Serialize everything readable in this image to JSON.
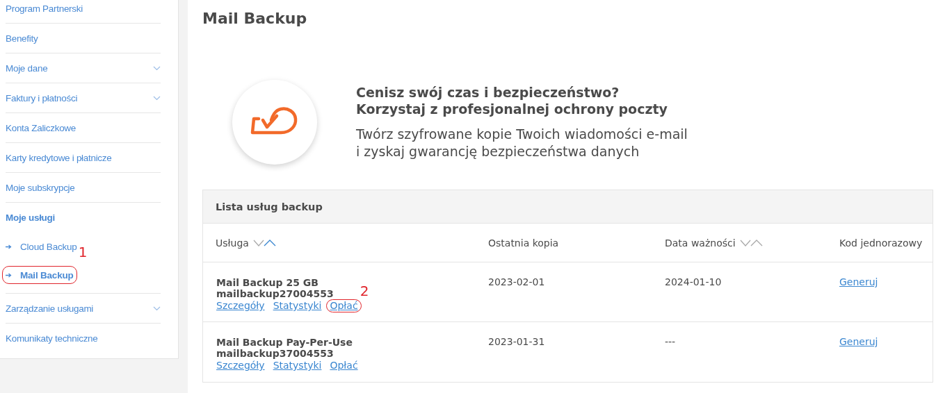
{
  "sidebar": {
    "items": [
      {
        "label": "Program Partnerski",
        "kind": "link"
      },
      {
        "label": "Benefity",
        "kind": "link"
      },
      {
        "label": "Moje dane",
        "kind": "group"
      },
      {
        "label": "Faktury i płatności",
        "kind": "group"
      },
      {
        "label": "Konta Zaliczkowe",
        "kind": "link"
      },
      {
        "label": "Karty kredytowe i płatnicze",
        "kind": "link"
      },
      {
        "label": "Moje subskrypcje",
        "kind": "link"
      },
      {
        "label": "Moje usługi",
        "kind": "section",
        "children": [
          {
            "label": "Cloud Backup",
            "selected": false
          },
          {
            "label": "Mail Backup",
            "selected": true,
            "annotation": "1"
          }
        ]
      },
      {
        "label": "Zarządzanie usługami",
        "kind": "group"
      },
      {
        "label": "Komunikaty techniczne",
        "kind": "link"
      }
    ]
  },
  "page_title": "Mail Backup",
  "banner": {
    "heading": [
      "Cenisz swój czas i bezpieczeństwo?",
      "Korzystaj z profesjonalnej ochrony poczty"
    ],
    "text": [
      "Twórz szyfrowane kopie Twoich wiadomości e-mail",
      "i zyskaj gwarancję bezpieczeństwa danych"
    ]
  },
  "table": {
    "title": "Lista usług backup",
    "columns": [
      {
        "label": "Usługa",
        "sorted": true
      },
      {
        "label": "Ostatnia kopia"
      },
      {
        "label": "Data ważności",
        "sorted": false
      },
      {
        "label": "Kod jednorazowy"
      }
    ],
    "rows": [
      {
        "service": "Mail Backup 25 GB",
        "account": "mailbackup27004553",
        "actions": [
          {
            "label": "Szczegóły"
          },
          {
            "label": "Statystyki"
          },
          {
            "label": "Opłać",
            "annotation": "2"
          }
        ],
        "last_backup": "2023-02-01",
        "expiry": "2024-01-10",
        "code": "Generuj"
      },
      {
        "service": "Mail Backup Pay-Per-Use",
        "account": "mailbackup37004553",
        "actions": [
          {
            "label": "Szczegóły"
          },
          {
            "label": "Statystyki"
          },
          {
            "label": "Opłać"
          }
        ],
        "last_backup": "2023-01-31",
        "expiry": "---",
        "code": "Generuj"
      }
    ]
  }
}
